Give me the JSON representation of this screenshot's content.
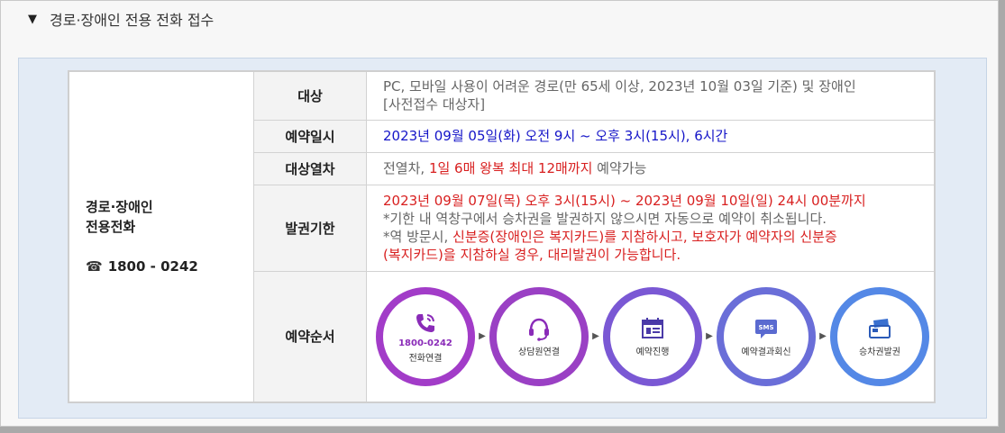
{
  "section": {
    "title": "경로·장애인 전용 전화 접수"
  },
  "left": {
    "title_line1": "경로·장애인",
    "title_line2": "전용전화",
    "phone": "1800 - 0242"
  },
  "rows": {
    "target": {
      "label": "대상",
      "line1": "PC, 모바일 사용이 어려운 경로(만 65세 이상, 2023년 10월 03일 기준) 및 장애인",
      "line2": "[사전접수 대상자]"
    },
    "datetime": {
      "label": "예약일시",
      "text": "2023년 09월 05일(화) 오전 9시 ~ 오후 3시(15시), 6시간"
    },
    "trains": {
      "label": "대상열차",
      "pre": "전열차, ",
      "highlight": "1일 6매 왕복 최대 12매까지",
      "post": " 예약가능"
    },
    "deadline": {
      "label": "발권기한",
      "line1": "2023년 09월 07일(목) 오후 3시(15시) ~ 2023년 09월 10일(일) 24시 00분까지",
      "line2": "*기한 내 역창구에서 승차권을 발권하지 않으시면 자동으로 예약이 취소됩니다.",
      "line3_pre": "*역 방문시, ",
      "line3_red": "신분증(장애인은 복지카드)를 지참하시고, 보호자가 예약자의 신분증",
      "line4_red": "(복지카드)을 지참하실 경우, 대리발권이 가능합니다."
    },
    "order": {
      "label": "예약순서"
    }
  },
  "steps": [
    {
      "icon": "phone-call-icon",
      "number": "1800-0242",
      "caption": "전화연결",
      "color": "#a23cc8"
    },
    {
      "icon": "headset-icon",
      "caption": "상담원연결",
      "color": "#9a40c4"
    },
    {
      "icon": "calendar-icon",
      "caption": "예약진행",
      "color": "#7a58d4"
    },
    {
      "icon": "sms-icon",
      "caption": "예약결과회신",
      "color": "#6a6ed8"
    },
    {
      "icon": "ticket-card-icon",
      "caption": "승차권발권",
      "color": "#5488e6"
    }
  ]
}
